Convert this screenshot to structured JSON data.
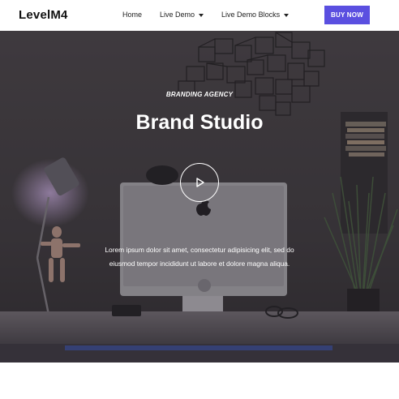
{
  "header": {
    "logo": "LevelM4",
    "nav": [
      {
        "label": "Home",
        "has_caret": false
      },
      {
        "label": "Live Demo",
        "has_caret": true
      },
      {
        "label": "Live Demo Blocks",
        "has_caret": true
      }
    ],
    "cta_label": "BUY NOW"
  },
  "hero": {
    "eyebrow": "BRANDING AGENCY",
    "title": "Brand Studio",
    "play_icon": "play-icon",
    "description_line1": "Lorem ipsum dolor sit amet, consectetur adipisicing elit, sed do",
    "description_line2": "eiusmod tempor incididunt ut labore et dolore magna aliqua."
  },
  "colors": {
    "accent": "#5a4fe0",
    "hero_overlay": "#2e2a30"
  }
}
